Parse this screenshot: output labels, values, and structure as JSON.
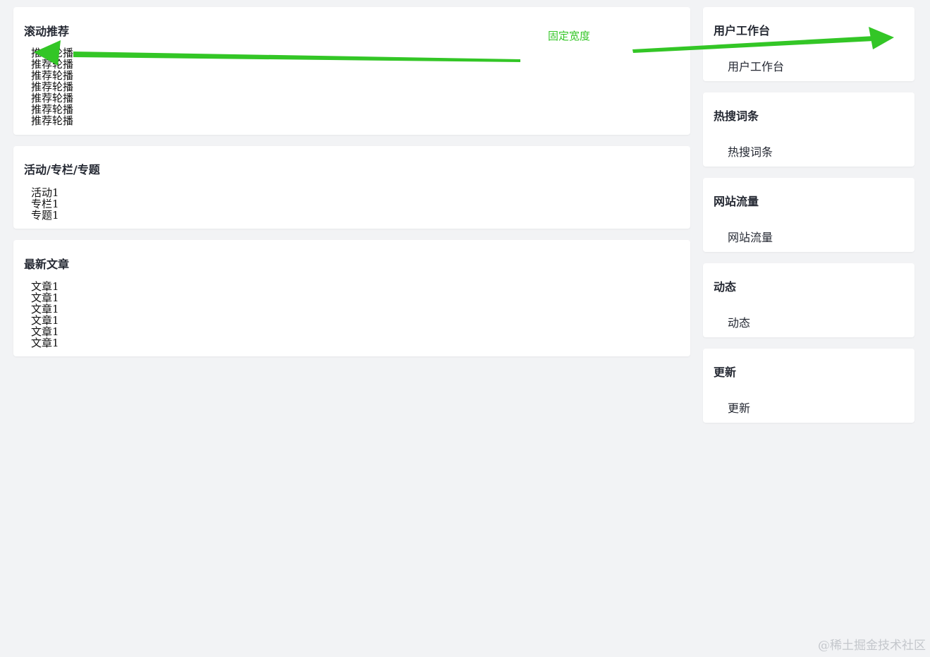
{
  "main": {
    "scroll_card": {
      "title": "滚动推荐",
      "items": [
        "推荐轮播",
        "推荐轮播",
        "推荐轮播",
        "推荐轮播",
        "推荐轮播",
        "推荐轮播",
        "推荐轮播"
      ]
    },
    "activity_card": {
      "title": "活动/专栏/专题",
      "items": [
        "活动1",
        "专栏1",
        "专题1"
      ]
    },
    "articles_card": {
      "title": "最新文章",
      "items": [
        "文章1",
        "文章1",
        "文章1",
        "文章1",
        "文章1",
        "文章1"
      ]
    }
  },
  "sidebar": {
    "cards": [
      {
        "title": "用户工作台",
        "content": "用户工作台"
      },
      {
        "title": "热搜词条",
        "content": "热搜词条"
      },
      {
        "title": "网站流量",
        "content": "网站流量"
      },
      {
        "title": "动态",
        "content": "动态"
      },
      {
        "title": "更新",
        "content": "更新"
      }
    ]
  },
  "annotation": {
    "label": "固定宽度",
    "color": "#33c626"
  },
  "watermark": "@稀土掘金技术社区"
}
